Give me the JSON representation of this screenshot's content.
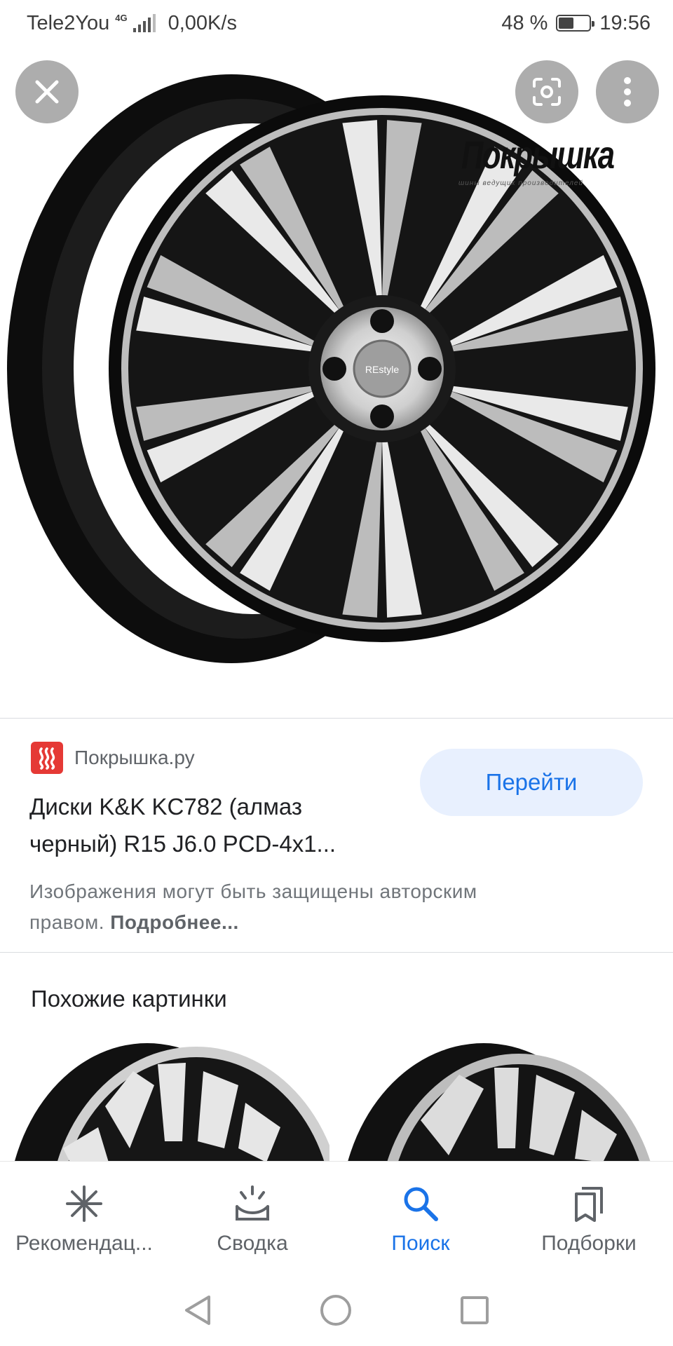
{
  "status_bar": {
    "carrier": "Tele2You",
    "network_type": "4G",
    "speed": "0,00K/s",
    "battery_percent_label": "48 %",
    "battery_level": 0.48,
    "time": "19:56"
  },
  "viewer": {
    "close_icon": "close-icon",
    "lens_icon": "lens-search-icon",
    "more_icon": "more-vertical-icon",
    "watermark_title": "Покрышка",
    "watermark_subtitle": "шины ведущих производителей",
    "hub_label": "REstyle"
  },
  "result": {
    "source_name": "Покрышка.ру",
    "title_line1": "Диски K&K KC782 (алмаз",
    "title_line2": "черный) R15 J6.0 PCD-4x1...",
    "visit_button": "Перейти",
    "copyright_line1": "Изображения могут быть защищены авторским",
    "copyright_line2": "правом.",
    "more_link": "Подробнее..."
  },
  "similar": {
    "heading": "Похожие картинки"
  },
  "bottom_nav": {
    "items": [
      {
        "label": "Рекомендац...",
        "icon": "asterisk-icon"
      },
      {
        "label": "Сводка",
        "icon": "updates-icon"
      },
      {
        "label": "Поиск",
        "icon": "search-icon"
      },
      {
        "label": "Подборки",
        "icon": "collections-icon"
      }
    ],
    "active_index": 2
  },
  "colors": {
    "accent": "#1a73e8",
    "button_bg": "#e8f0fe",
    "logo_red": "#e53935",
    "text_primary": "#202124",
    "text_secondary": "#5f6368"
  }
}
